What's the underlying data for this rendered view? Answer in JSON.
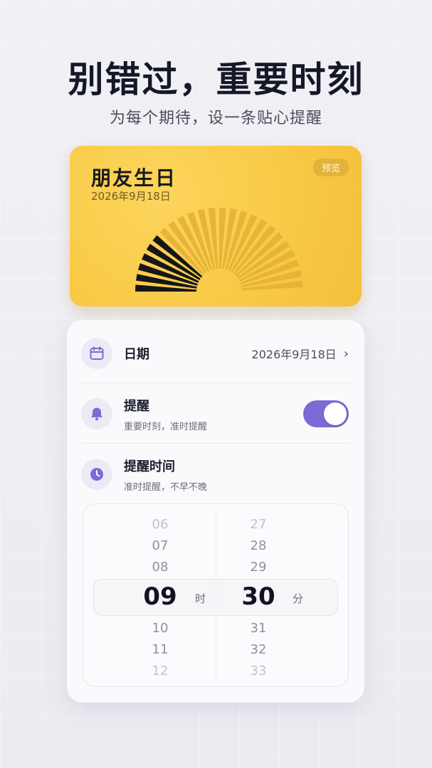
{
  "header": {
    "title": "别错过，重要时刻",
    "subtitle": "为每个期待，设一条贴心提醒"
  },
  "preview": {
    "title": "朋友生日",
    "date": "2026年9月18日",
    "badge": "预览",
    "background_color": "#f8c944"
  },
  "settings": {
    "date_row": {
      "label": "日期",
      "value": "2026年9月18日",
      "icon": "calendar-icon"
    },
    "reminder_row": {
      "label": "提醒",
      "sub": "重要时刻，准时提醒",
      "icon": "bell-icon",
      "enabled": true
    },
    "time_row": {
      "label": "提醒时间",
      "sub": "准时提醒，不早不晚",
      "icon": "clock-icon"
    }
  },
  "picker": {
    "hours": [
      "06",
      "07",
      "08",
      "09",
      "10",
      "11",
      "12"
    ],
    "minutes": [
      "27",
      "28",
      "29",
      "30",
      "31",
      "32",
      "33"
    ],
    "selected_hour": "09",
    "selected_minute": "30",
    "hour_unit": "时",
    "minute_unit": "分"
  },
  "colors": {
    "accent": "#7c6ad6",
    "card_yellow": "#f8c944"
  }
}
